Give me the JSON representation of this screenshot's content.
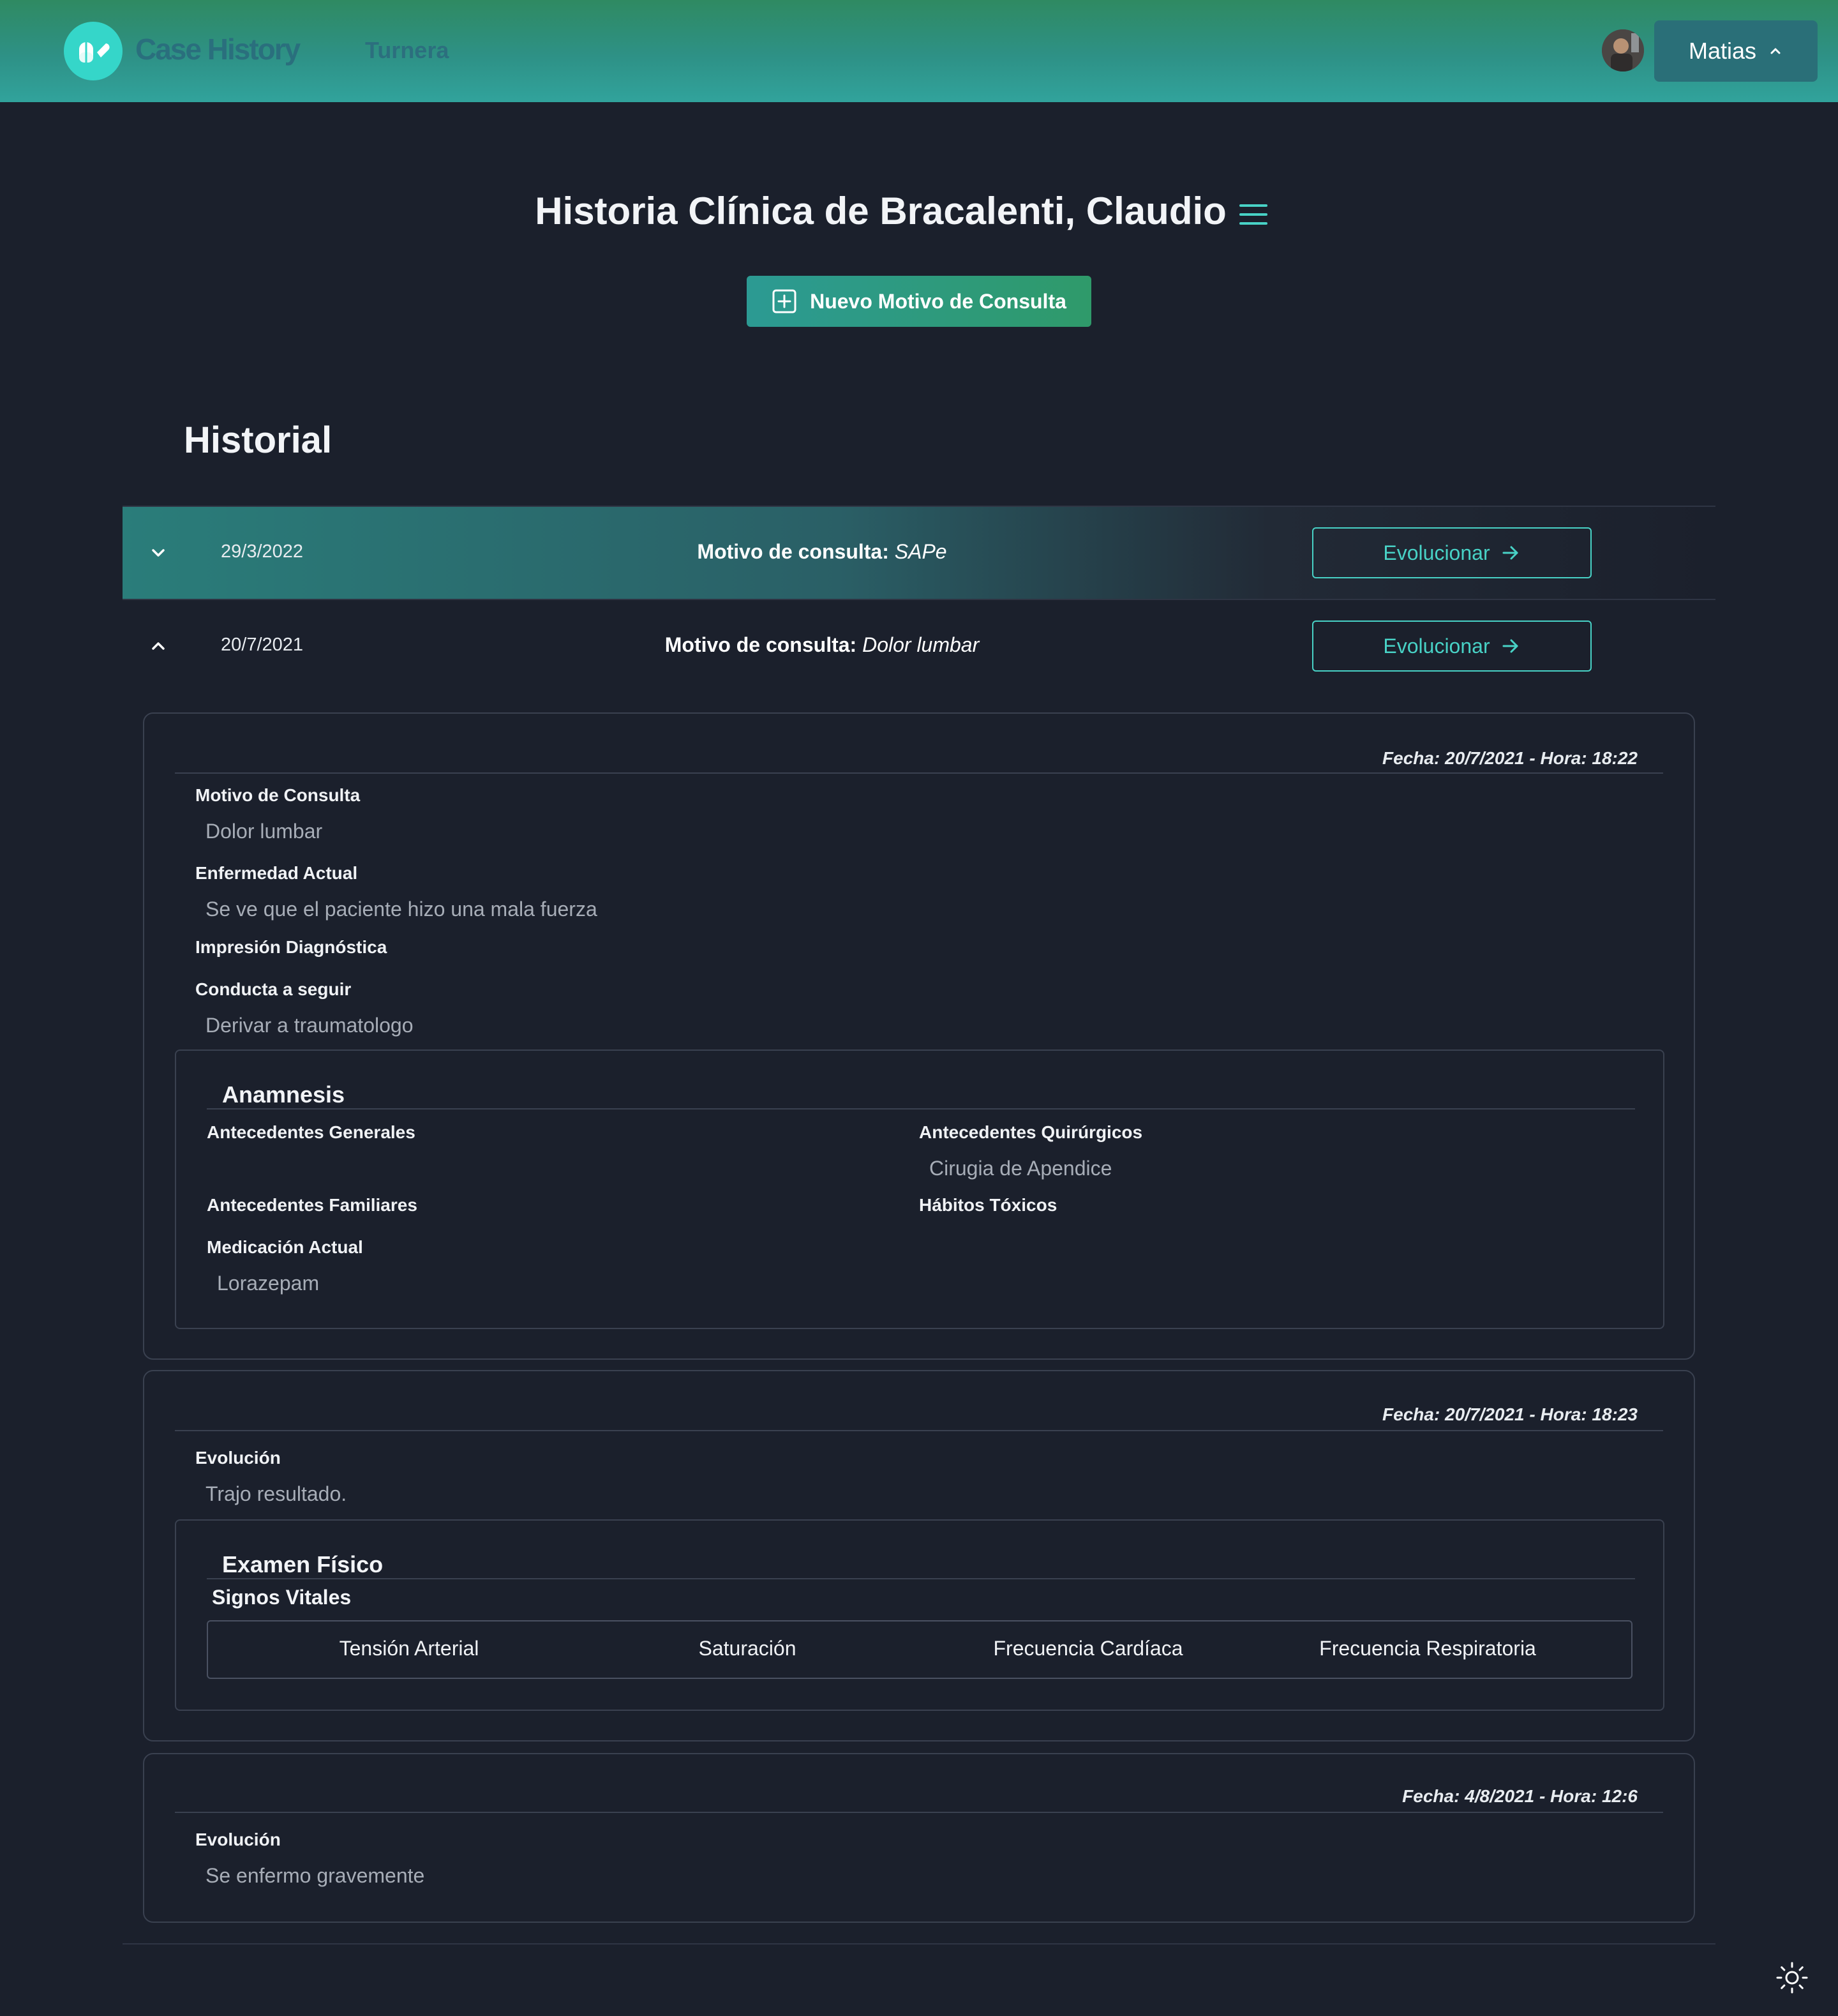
{
  "nav": {
    "brand": "Case History",
    "link": "Turnera",
    "user": "Matias"
  },
  "header": {
    "title": "Historia Clínica de Bracalenti, Claudio",
    "new_button": "Nuevo Motivo de Consulta"
  },
  "history": {
    "title": "Historial",
    "motivo_label": "Motivo de consulta:",
    "evolve_label": "Evolucionar",
    "rows": [
      {
        "date": "29/3/2022",
        "motivo": "SAPe"
      },
      {
        "date": "20/7/2021",
        "motivo": "Dolor lumbar"
      }
    ]
  },
  "consulta": {
    "stamp": "Fecha: 20/7/2021 - Hora: 18:22",
    "motivo_label": "Motivo de Consulta",
    "motivo_value": "Dolor lumbar",
    "enfermedad_label": "Enfermedad Actual",
    "enfermedad_value": "Se ve que el paciente hizo una mala fuerza",
    "impresion_label": "Impresión Diagnóstica",
    "conducta_label": "Conducta a seguir",
    "conducta_value": "Derivar a traumatologo",
    "anamnesis": {
      "title": "Anamnesis",
      "generales_label": "Antecedentes Generales",
      "quirurgicos_label": "Antecedentes Quirúrgicos",
      "quirurgicos_value": "Cirugia de Apendice",
      "familiares_label": "Antecedentes Familiares",
      "toxicos_label": "Hábitos Tóxicos",
      "medicacion_label": "Medicación Actual",
      "medicacion_value": "Lorazepam"
    }
  },
  "evolucion1": {
    "stamp": "Fecha: 20/7/2021 - Hora: 18:23",
    "label": "Evolución",
    "value": "Trajo resultado.",
    "examen": {
      "title": "Examen Físico",
      "subtitle": "Signos Vitales",
      "columns": [
        "Tensión Arterial",
        "Saturación",
        "Frecuencia Cardíaca",
        "Frecuencia Respiratoria"
      ]
    }
  },
  "evolucion2": {
    "stamp": "Fecha: 4/8/2021 - Hora: 12:6",
    "label": "Evolución",
    "value": "Se enfermo gravemente"
  },
  "colors": {
    "accent": "#48d2c6",
    "background": "#1b202c",
    "topbar_green": "#2f8a62",
    "topbar_teal": "#31a39c"
  }
}
